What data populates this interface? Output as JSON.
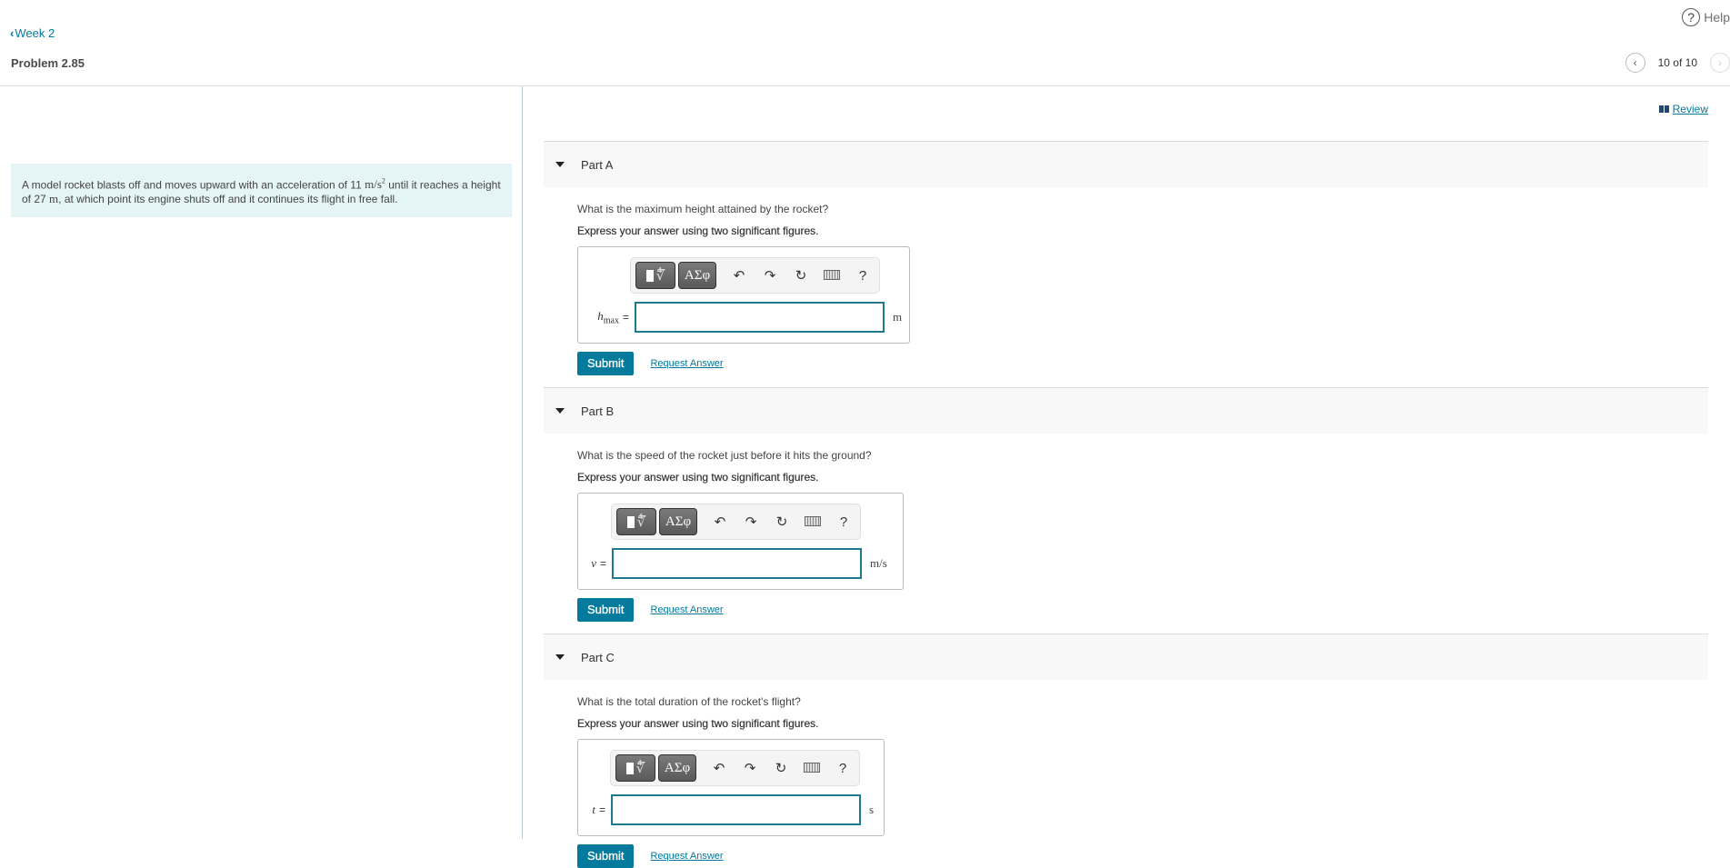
{
  "header": {
    "help_label": "Help",
    "help_icon": "question-circle-icon",
    "back_label": "Week 2",
    "problem_title": "Problem 2.85",
    "pager": {
      "current": 10,
      "total": 10,
      "text": "10 of 10"
    },
    "review_label": "Review"
  },
  "problem": {
    "text_before_accel": "A model rocket blasts off and moves upward with an acceleration of 11 ",
    "accel_unit": "m/s",
    "accel_exp": "2",
    "text_mid": " until it reaches a height of 27 ",
    "height_unit": "m",
    "text_end": ", at which point its engine shuts off and it continues its flight in free fall."
  },
  "toolbar": {
    "templates_icon": "templates-icon",
    "greek_label": "ΑΣφ",
    "undo_icon": "undo-icon",
    "redo_icon": "redo-icon",
    "reset_icon": "reset-icon",
    "keyboard_icon": "keyboard-icon",
    "help_label": "?"
  },
  "parts": [
    {
      "label": "Part A",
      "question": "What is the maximum height attained by the rocket?",
      "instruction": "Express your answer using two significant figures.",
      "variable": "h",
      "variable_sub": "max",
      "equals": "=",
      "input_value": "",
      "unit": "m",
      "submit_label": "Submit",
      "request_label": "Request Answer"
    },
    {
      "label": "Part B",
      "question": "What is the speed of the rocket just before it hits the ground?",
      "instruction": "Express your answer using two significant figures.",
      "variable": "v",
      "variable_sub": "",
      "equals": "=",
      "input_value": "",
      "unit": "m/s",
      "submit_label": "Submit",
      "request_label": "Request Answer"
    },
    {
      "label": "Part C",
      "question": "What is the total duration of the rocket's flight?",
      "instruction": "Express your answer using two significant figures.",
      "variable": "t",
      "variable_sub": "",
      "equals": "=",
      "input_value": "",
      "unit": "s",
      "submit_label": "Submit",
      "request_label": "Request Answer"
    }
  ]
}
